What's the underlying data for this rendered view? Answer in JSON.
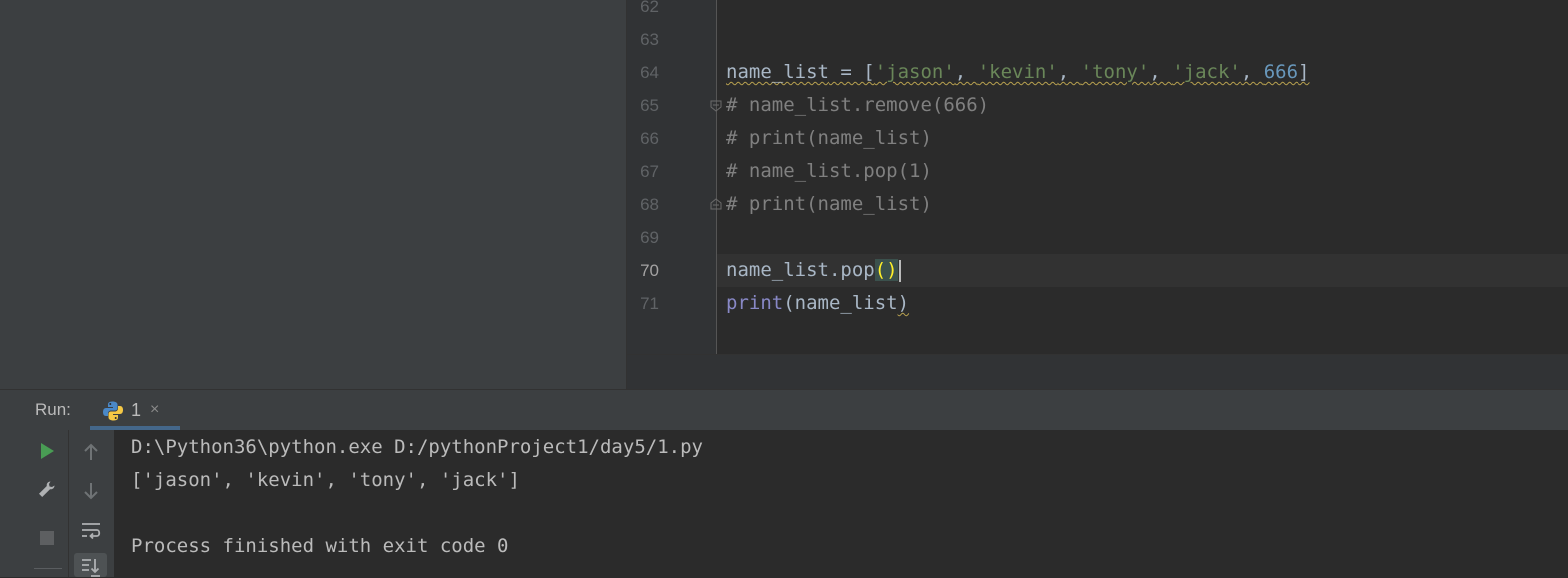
{
  "editor": {
    "lines": [
      {
        "num": "62",
        "active": false
      },
      {
        "num": "63",
        "active": false
      },
      {
        "num": "64",
        "active": false
      },
      {
        "num": "65",
        "active": false
      },
      {
        "num": "66",
        "active": false
      },
      {
        "num": "67",
        "active": false
      },
      {
        "num": "68",
        "active": false
      },
      {
        "num": "69",
        "active": false
      },
      {
        "num": "70",
        "active": true
      },
      {
        "num": "71",
        "active": false
      }
    ],
    "code": {
      "l64_var": "name_list",
      "l64_eq": " = [",
      "l64_s1": "'jason'",
      "l64_sep1": ", ",
      "l64_s2": "'kevin'",
      "l64_sep2": ", ",
      "l64_s3": "'tony'",
      "l64_sep3": ", ",
      "l64_s4": "'jack'",
      "l64_sep4": ", ",
      "l64_n": "666",
      "l64_close": "]",
      "l65": "# name_list.remove(666)",
      "l66": "# print(name_list)",
      "l67": "# name_list.pop(1)",
      "l68": "# print(name_list)",
      "l70_text": "name_list.pop",
      "l70_parens": "()",
      "l71_builtin": "print",
      "l71_rest": "(name_list",
      "l71_close": ")"
    }
  },
  "run_panel": {
    "label": "Run:",
    "tab_name": "1",
    "tab_close": "×",
    "console": [
      "D:\\Python36\\python.exe D:/pythonProject1/day5/1.py",
      "['jason', 'kevin', 'tony', 'jack']",
      "",
      "Process finished with exit code 0"
    ]
  },
  "icons": {
    "run": "play-icon",
    "settings": "wrench-icon",
    "stop": "stop-icon",
    "up": "arrow-up-icon",
    "down": "arrow-down-icon",
    "wrap": "soft-wrap-icon",
    "scroll": "scroll-to-end-icon",
    "python": "python-icon"
  },
  "colors": {
    "accent_run": "#499c54",
    "string": "#6a8759",
    "number": "#6897bb",
    "comment": "#808080",
    "builtin": "#8888c6"
  }
}
